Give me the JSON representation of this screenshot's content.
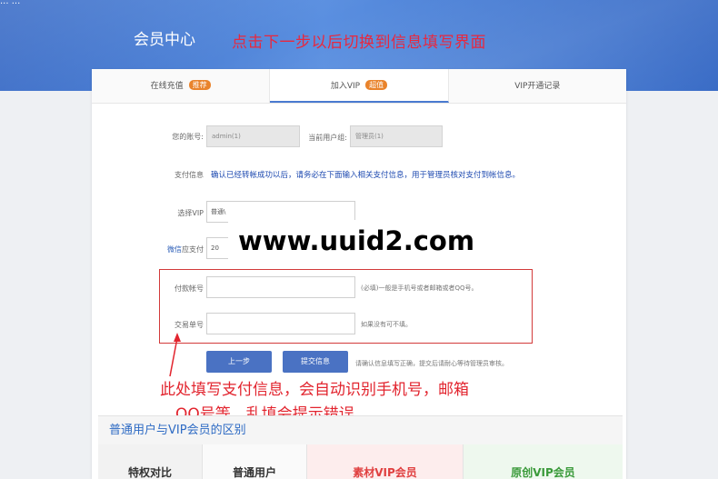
{
  "header": {
    "top_chars": "... ...",
    "title": "会员中心",
    "annotation": "点击下一步以后切换到信息填写界面"
  },
  "tabs": [
    {
      "label": "在线充值",
      "badge": "推荐"
    },
    {
      "label": "加入VIP",
      "badge": "超值"
    },
    {
      "label": "VIP开通记录",
      "badge": ""
    }
  ],
  "form": {
    "account_label": "您的账号:",
    "account_value": "admin(1)",
    "group_label": "当前用户组:",
    "group_value": "管理员(1)",
    "payinfo_label": "支付信息",
    "payinfo_text": "确认已经转帐成功以后，请务必在下面输入相关支付信息，用于管理员核对支付到帐信息。",
    "vip_label": "选择VIP",
    "vip_value": "普通\\",
    "should_pay_prefix": "微信",
    "should_pay_label": "应支付",
    "should_pay_value": "20",
    "pay_account_label": "付款帐号",
    "pay_account_value": "",
    "pay_account_note": "(必填)一般是手机号或者邮箱或者QQ号。",
    "trade_no_label": "交易单号",
    "trade_no_value": "",
    "trade_no_note": "如果没有可不填。",
    "prev_button": "上一步",
    "submit_button": "提交信息",
    "submit_note": "请确认信息填写正确，提交后请耐心等待管理员审核。"
  },
  "watermark": "www.uuid2.com",
  "annotation": {
    "line1": "此处填写支付信息，会自动识别手机号，邮箱",
    "line2": "，QQ号等。乱填会提示错误。"
  },
  "compare": {
    "title": "普通用户与VIP会员的区别",
    "headers": [
      "特权对比",
      "普通用户",
      "素材VIP会员",
      "原创VIP会员"
    ]
  },
  "colors": {
    "header_blue": "#4a7ed6",
    "annotation_red": "#e2242e",
    "button_blue": "#4a72c3",
    "badge_orange": "#e9832b",
    "payinfo_blue": "#1e4ab0"
  }
}
